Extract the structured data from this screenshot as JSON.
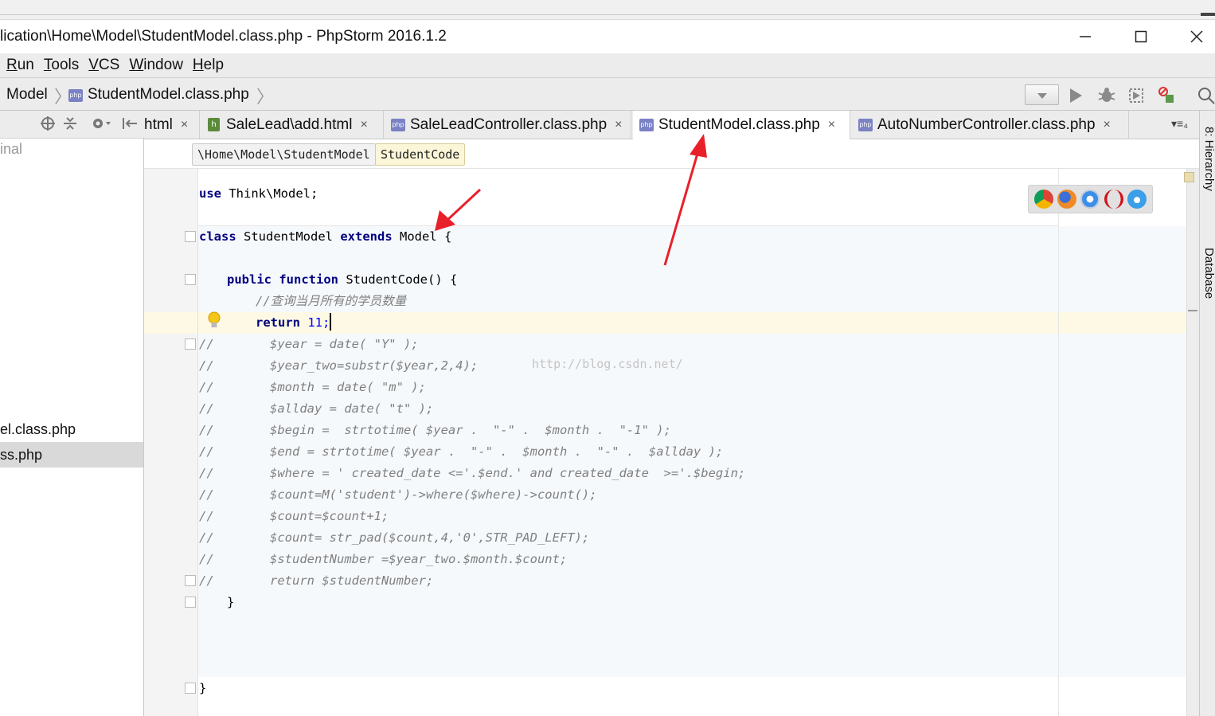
{
  "window": {
    "title": "lication\\Home\\Model\\StudentModel.class.php - PhpStorm 2016.1.2",
    "minimize_icon": "minimize-icon",
    "maximize_icon": "maximize-icon",
    "close_icon": "close-icon"
  },
  "menu": [
    {
      "label": "Run",
      "u": "R",
      "rest": "un"
    },
    {
      "label": "Tools",
      "u": "T",
      "rest": "ools"
    },
    {
      "label": "VCS",
      "u": "V",
      "rest": "CS"
    },
    {
      "label": "Window",
      "u": "W",
      "rest": "indow"
    },
    {
      "label": "Help",
      "u": "H",
      "rest": "elp"
    }
  ],
  "nav": {
    "crumb1": "Model",
    "crumb2": "StudentModel.class.php",
    "file_icon": "php"
  },
  "left_panel": {
    "dim_item": "inal",
    "item1": "el.class.php",
    "item2": "ss.php"
  },
  "tabs": [
    {
      "label": "html",
      "icon": "",
      "active": false
    },
    {
      "label": "SaleLead\\add.html",
      "icon": "h",
      "active": false
    },
    {
      "label": "SaleLeadController.class.php",
      "icon": "php",
      "active": false
    },
    {
      "label": "StudentModel.class.php",
      "icon": "php",
      "active": true
    },
    {
      "label": "AutoNumberController.class.php",
      "icon": "php",
      "active": false
    }
  ],
  "tab_close": "×",
  "tab_overflow": "▾≡₄",
  "right_strip": {
    "hierarchy": "8: Hierarchy",
    "database": "Database"
  },
  "editor": {
    "breadcrumb_path": "\\Home\\Model\\StudentModel",
    "breadcrumb_method": "StudentCode",
    "watermark": "http://blog.csdn.net/",
    "lines": {
      "l1_kw": "use",
      "l1_rest": " Think\\Model;",
      "l2_kw1": "class",
      "l2_mid": " StudentModel ",
      "l2_kw2": "extends",
      "l2_end": " Model {",
      "l3_kw1": "public",
      "l3_kw2": "function",
      "l3_end": " StudentCode() {",
      "l4_comment": "//查询当月所有的学员数量",
      "l5_kw": "return",
      "l5_num": " 11;",
      "c1": "$year = date( \"Y\" );",
      "c2": "$year_two=substr($year,2,4);",
      "c3": "$month = date( \"m\" );",
      "c4": "$allday = date( \"t\" );",
      "c5": "$begin =  strtotime( $year .  \"-\" .  $month .  \"-1\" );",
      "c6": "$end = strtotime( $year .  \"-\" .  $month .  \"-\" .  $allday );",
      "c7": "$where = ' created_date <='.$end.' and created_date  >='.$begin;",
      "c8": "$count=M('student')->where($where)->count();",
      "c9": "$count=$count+1;",
      "c10": "$count= str_pad($count,4,'0',STR_PAD_LEFT);",
      "c11": "$studentNumber =$year_two.$month.$count;",
      "c12": "return $studentNumber;",
      "comment_prefix": "//",
      "close_method": "}",
      "close_class": "}"
    }
  },
  "colors": {
    "keyword": "#000080",
    "comment": "#808080",
    "arrow": "#e8202a",
    "caret_row": "#fdf9e4"
  }
}
